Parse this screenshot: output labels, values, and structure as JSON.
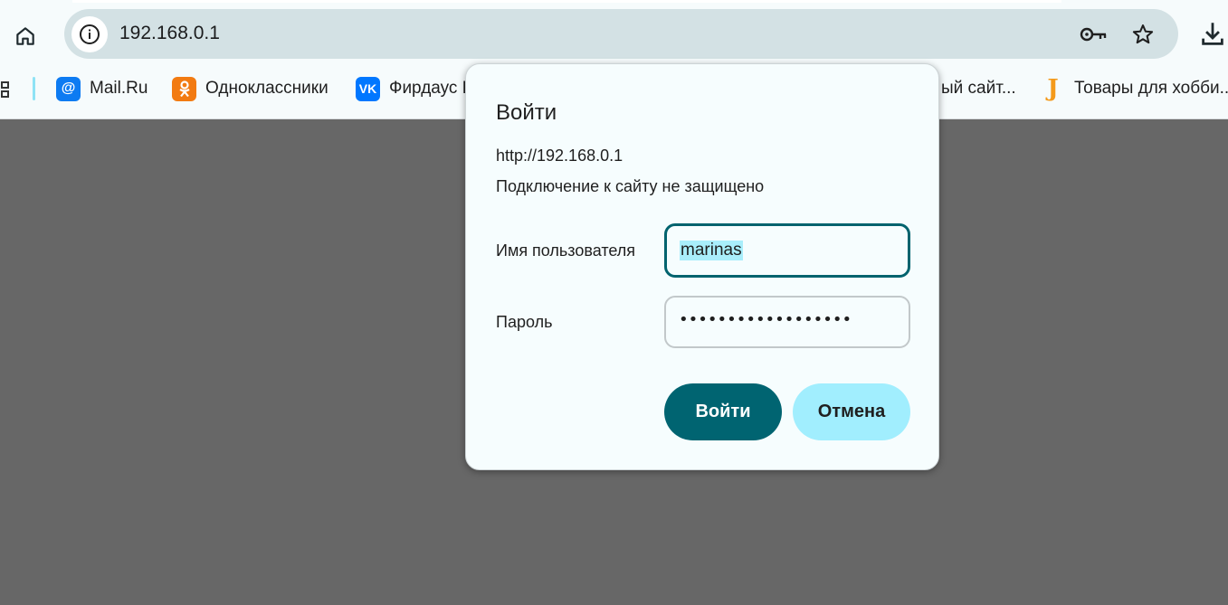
{
  "toolbar": {
    "url": "192.168.0.1"
  },
  "bookmarks": [
    {
      "label": "Mail.Ru",
      "icon": "mailru-at-icon",
      "color": "#0d7bf2"
    },
    {
      "label": "Одноклассники",
      "icon": "odnoklassniki-icon",
      "color": "#f27b12"
    },
    {
      "label": "Фирдаус Н",
      "icon": "vk-icon",
      "color": "#0077ff"
    },
    {
      "label": "ый сайт...",
      "icon": "",
      "color": ""
    },
    {
      "label": "Товары для хобби...",
      "icon": "yarn-shop-icon",
      "color": "#f49a1b"
    }
  ],
  "dialog": {
    "title": "Войти",
    "url": "http://192.168.0.1",
    "warning": "Подключение к сайту не защищено",
    "username_label": "Имя пользователя",
    "username_value": "marinas",
    "password_label": "Пароль",
    "password_value": "••••••••••••••••••",
    "login_button": "Войти",
    "cancel_button": "Отмена"
  },
  "colors": {
    "accent": "#006471",
    "secondary_button": "#a1eefe",
    "backdrop": "#676767"
  }
}
